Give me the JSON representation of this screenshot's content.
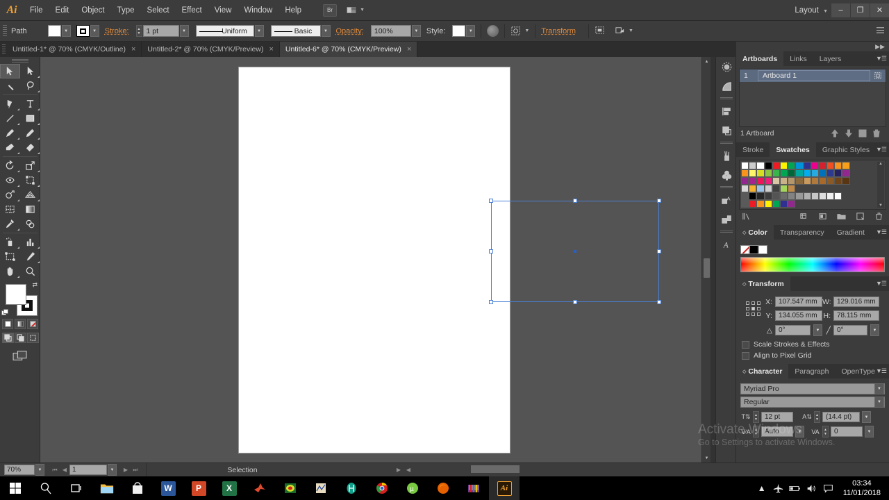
{
  "app": {
    "name": "Adobe Illustrator",
    "logo": "Ai"
  },
  "menubar": {
    "items": [
      "File",
      "Edit",
      "Object",
      "Type",
      "Select",
      "Effect",
      "View",
      "Window",
      "Help"
    ],
    "bridge_label": "Br",
    "workspace": "Layout",
    "window_buttons": {
      "minimize": "–",
      "restore": "❐",
      "close": "✕"
    }
  },
  "controlbar": {
    "object_label": "Path",
    "stroke_label": "Stroke:",
    "stroke_weight": "1 pt",
    "stroke_profile": "Uniform",
    "brush_definition": "Basic",
    "opacity_label": "Opacity:",
    "opacity_value": "100%",
    "style_label": "Style:",
    "transform_label": "Transform"
  },
  "tabs": [
    {
      "label": "Untitled-1* @ 70% (CMYK/Outline)",
      "close": "×",
      "active": false
    },
    {
      "label": "Untitled-2* @ 70% (CMYK/Preview)",
      "close": "×",
      "active": false
    },
    {
      "label": "Untitled-6* @ 70% (CMYK/Preview)",
      "close": "×",
      "active": true
    }
  ],
  "toolbar": {
    "tools": [
      "selection-tool",
      "direct-selection-tool",
      "magic-wand-tool",
      "lasso-tool",
      "pen-tool",
      "type-tool",
      "line-segment-tool",
      "rectangle-tool",
      "paintbrush-tool",
      "pencil-tool",
      "blob-brush-tool",
      "eraser-tool",
      "rotate-tool",
      "scale-tool",
      "width-tool",
      "free-transform-tool",
      "shape-builder-tool",
      "perspective-grid-tool",
      "mesh-tool",
      "gradient-tool",
      "eyedropper-tool",
      "blend-tool",
      "symbol-sprayer-tool",
      "column-graph-tool",
      "artboard-tool",
      "slice-tool",
      "hand-tool",
      "zoom-tool"
    ],
    "fill_color": "#ffffff",
    "stroke_color": "#000000"
  },
  "canvas": {
    "artboard_background": "#ffffff",
    "selection_color": "#4a7fd4",
    "handle_count": 8
  },
  "statusbar": {
    "zoom": "70%",
    "page": "1",
    "status": "Selection"
  },
  "panels": {
    "artboards": {
      "tabs": [
        "Artboards",
        "Links",
        "Layers"
      ],
      "active_tab": "Artboards",
      "rows": [
        {
          "index": "1",
          "name": "Artboard 1"
        }
      ],
      "footer": "1 Artboard"
    },
    "swatches": {
      "tabs": [
        "Stroke",
        "Swatches",
        "Graphic Styles"
      ],
      "active_tab": "Swatches"
    },
    "color": {
      "tabs": [
        "Color",
        "Transparency",
        "Gradient"
      ],
      "active_tab": "Color"
    },
    "transform": {
      "title": "Transform",
      "x_label": "X:",
      "x_value": "107.547 mm",
      "y_label": "Y:",
      "y_value": "134.055 mm",
      "w_label": "W:",
      "w_value": "129.016 mm",
      "h_label": "H:",
      "h_value": "78.115 mm",
      "rotate_value": "0°",
      "shear_value": "0°",
      "scale_strokes_label": "Scale Strokes & Effects",
      "align_pixel_label": "Align to Pixel Grid"
    },
    "character": {
      "tabs": [
        "Character",
        "Paragraph",
        "OpenType"
      ],
      "active_tab": "Character",
      "font_family": "Myriad Pro",
      "font_style": "Regular",
      "font_size": "12 pt",
      "leading": "(14.4 pt)",
      "kerning": "Auto",
      "tracking": "0"
    }
  },
  "watermark": {
    "line1": "Activate Windows",
    "line2": "Go to Settings to activate Windows."
  },
  "taskbar": {
    "items": [
      {
        "name": "start-button",
        "glyph": "⊞",
        "color": "#ffffff",
        "type": "glyph"
      },
      {
        "name": "search-icon",
        "glyph": "⚲",
        "color": "#ffffff",
        "type": "glyph"
      },
      {
        "name": "task-view-icon",
        "glyph": "▣",
        "color": "#ffffff",
        "type": "glyph"
      },
      {
        "name": "file-explorer-icon",
        "label": "",
        "color": "#f5bc42",
        "type": "tile"
      },
      {
        "name": "microsoft-store-icon",
        "label": "",
        "color": "#e8e8e8",
        "type": "tile"
      },
      {
        "name": "word-icon",
        "label": "W",
        "color": "#2b579a",
        "type": "tile"
      },
      {
        "name": "powerpoint-icon",
        "label": "P",
        "color": "#d24726",
        "type": "tile"
      },
      {
        "name": "excel-icon",
        "label": "X",
        "color": "#217346",
        "type": "tile"
      },
      {
        "name": "matlab-icon",
        "label": "",
        "color": "#e04a2f",
        "type": "tile"
      },
      {
        "name": "comsol-icon",
        "label": "",
        "color": "#1a9a3c",
        "type": "tile"
      },
      {
        "name": "origin-icon",
        "label": "",
        "color": "#c9a227",
        "type": "tile"
      },
      {
        "name": "hfss-icon",
        "label": "",
        "color": "#12a08a",
        "type": "tile"
      },
      {
        "name": "chrome-icon",
        "label": "",
        "color": "#2a8f3e",
        "type": "tile"
      },
      {
        "name": "utorrent-icon",
        "label": "µ",
        "color": "#7ac943",
        "type": "tile"
      },
      {
        "name": "firefox-icon",
        "label": "",
        "color": "#e66000",
        "type": "tile"
      },
      {
        "name": "winrar-icon",
        "label": "",
        "color": "#8a4fa0",
        "type": "tile"
      },
      {
        "name": "illustrator-icon",
        "label": "Ai",
        "color": "#f0a030",
        "type": "tile",
        "active": true
      }
    ],
    "tray": [
      "ⱏ",
      "✈",
      "▭",
      "ᴘ",
      "⌨"
    ],
    "time": "03:34",
    "date": "11/01/2018"
  },
  "colors": {
    "accent_orange": "#e08a3c",
    "panel_bg": "#3c3c3c",
    "canvas_bg": "#545454",
    "selection_blue": "#4a7fd4"
  },
  "swatch_rows": [
    [
      "#ffffff",
      "#cccccc",
      "#ffffff",
      "#000000",
      "#ed1c24",
      "#fff200",
      "#00a651",
      "#0095da",
      "#2e3192",
      "#ec008c",
      "#d5202e",
      "#f04e23",
      "#f7941e",
      "#f9a01b"
    ],
    [
      "#f7941e",
      "#fff568",
      "#d7df23",
      "#8dc63f",
      "#39b54a",
      "#00a651",
      "#006838",
      "#00a79d",
      "#00aeef",
      "#27aae1",
      "#0072bc",
      "#2b3990",
      "#262262",
      "#92278f"
    ],
    [
      "#92278f",
      "#a6228f",
      "#ed145b",
      "#ed1e79",
      "#d9c6a5",
      "#c9b18a",
      "#b5976c",
      "#8a6a3e",
      "#c99a5b",
      "#b07a3c",
      "#a86a2a",
      "#8c5a24",
      "#6e4418",
      "#5a3512"
    ],
    [
      "#d8d8d8",
      "#f7b233",
      "#9bc4e8",
      "#cfcfcf",
      "#404040",
      "#a4d65e",
      "#c08a4a",
      "",
      "",
      "",
      "",
      "",
      "",
      ""
    ],
    [
      "#5a5a5a",
      "#000000",
      "#262626",
      "#3d3d3d",
      "#545454",
      "#6b6b6b",
      "#828282",
      "#999999",
      "#b0b0b0",
      "#c7c7c7",
      "#dedede",
      "#f0f0f0",
      "#ffffff",
      ""
    ],
    [
      "#5a5a5a",
      "#ed1c24",
      "#f7941e",
      "#fff200",
      "#00a651",
      "#2e3192",
      "#92278f",
      "",
      "",
      "",
      "",
      "",
      "",
      ""
    ]
  ]
}
